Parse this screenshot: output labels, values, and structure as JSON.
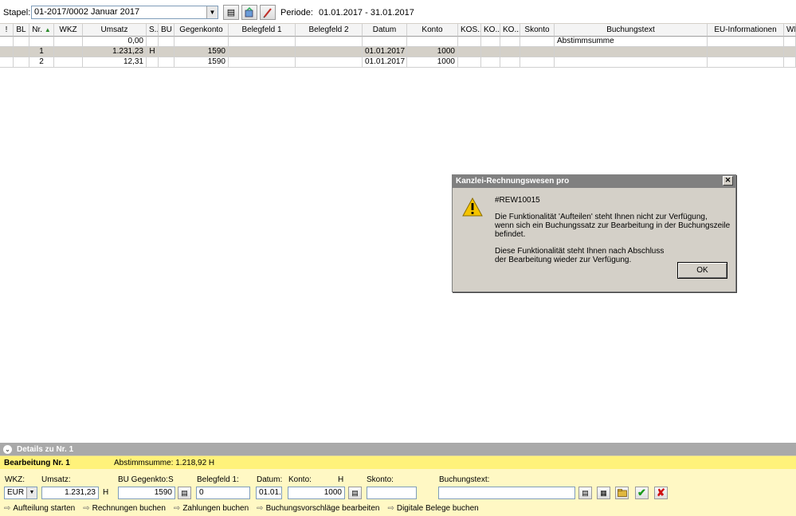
{
  "toolbar": {
    "stapel_label": "Stapel:",
    "stapel_value": "01-2017/0002  Januar 2017",
    "periode_label": "Periode:",
    "periode_value": "01.01.2017 - 31.01.2017"
  },
  "grid": {
    "headers": [
      "!",
      "BL",
      "Nr.",
      "WKZ",
      "Umsatz",
      "S...",
      "BU",
      "Gegenkonto",
      "Belegfeld 1",
      "Belegfeld 2",
      "Datum",
      "Konto",
      "KOS...",
      "KO...",
      "KO...",
      "Skonto",
      "Buchungstext",
      "EU-Informationen",
      "WK"
    ],
    "rows": [
      {
        "nr": "",
        "wkz": "",
        "umsatz": "0,00",
        "s": "",
        "bu": "",
        "gegenkonto": "",
        "beleg1": "",
        "beleg2": "",
        "datum": "",
        "konto": "",
        "skonto": "",
        "text": "Abstimmsumme",
        "eu": ""
      },
      {
        "nr": "1",
        "wkz": "",
        "umsatz": "1.231,23",
        "s": "H",
        "bu": "",
        "gegenkonto": "1590",
        "beleg1": "",
        "beleg2": "",
        "datum": "01.01.2017",
        "konto": "1000",
        "skonto": "",
        "text": "",
        "eu": ""
      },
      {
        "nr": "2",
        "wkz": "",
        "umsatz": "12,31",
        "s": "",
        "bu": "",
        "gegenkonto": "1590",
        "beleg1": "",
        "beleg2": "",
        "datum": "01.01.2017",
        "konto": "1000",
        "skonto": "",
        "text": "",
        "eu": ""
      }
    ]
  },
  "dialog": {
    "title": "Kanzlei-Rechnungswesen pro",
    "code": "#REW10015",
    "line1": "Die Funktionalität 'Aufteilen' steht Ihnen nicht zur Verfügung,",
    "line2": "wenn sich ein Buchungssatz zur Bearbeitung in der Buchungszeile befindet.",
    "line3": "Diese Funktionalität steht Ihnen nach Abschluss",
    "line4": "der Bearbeitung wieder zur Verfügung.",
    "ok_label": "OK",
    "close_glyph": "✕"
  },
  "details": {
    "label": "Details zu Nr. 1"
  },
  "edit": {
    "title": "Bearbeitung Nr. 1",
    "sum": "Abstimmsumme: 1.218,92 H",
    "labels": {
      "wkz": "WKZ:",
      "umsatz": "Umsatz:",
      "bu_gegenkonto": "BU Gegenkto:",
      "s": "S",
      "belegfeld1": "Belegfeld 1:",
      "datum": "Datum:",
      "konto": "Konto:",
      "h": "H",
      "skonto": "Skonto:",
      "buchungstext": "Buchungstext:"
    },
    "values": {
      "wkz": "EUR",
      "umsatz": "1.231,23",
      "umsatz_sh": "H",
      "gegenkonto": "1590",
      "belegfeld1": "0",
      "datum": "01.01.",
      "konto": "1000",
      "skonto": "",
      "buchungstext": ""
    },
    "links": [
      "Aufteilung starten",
      "Rechnungen buchen",
      "Zahlungen buchen",
      "Buchungsvorschläge bearbeiten",
      "Digitale Belege buchen"
    ]
  },
  "colors": {
    "edit_header": "#fff27a",
    "edit_panel": "#fff8c4",
    "details_bar": "#a9a9a9",
    "selected_row": "#d4d0c8"
  }
}
